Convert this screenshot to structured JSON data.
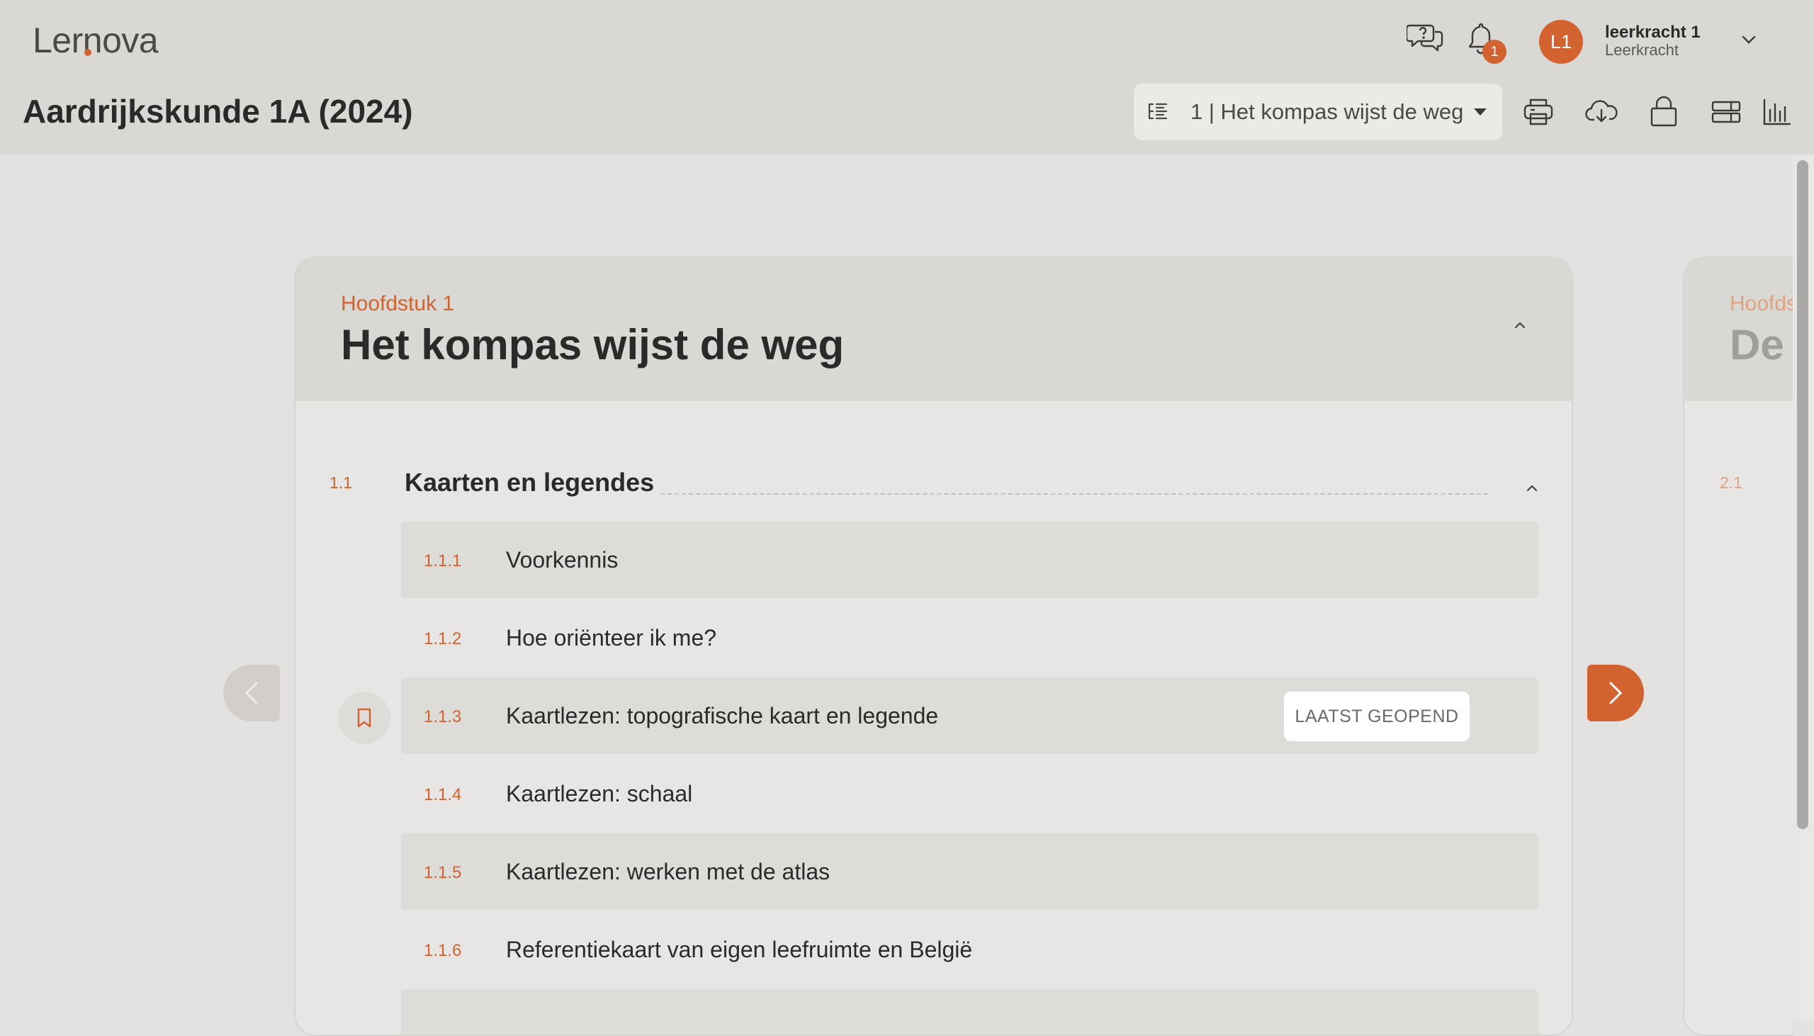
{
  "app": {
    "logo": "Lernova",
    "course_title": "Aardrijkskunde 1A (2024)"
  },
  "header": {
    "notifications_count": "1",
    "user": {
      "initials": "L1",
      "name": "leerkracht 1",
      "role": "Leerkracht"
    },
    "chapter_select": {
      "value": "1 | Het kompas wijst de weg"
    },
    "tools": [
      "print-icon",
      "cloud-download-icon",
      "lock-icon",
      "layout-icon",
      "bar-chart-icon"
    ]
  },
  "colors": {
    "accent": "#d2622f",
    "header_bg": "#d9d8d4",
    "page_bg": "#e3e2e0"
  },
  "chapter": {
    "kicker": "Hoofdstuk 1",
    "title": "Het kompas wijst de weg",
    "section": {
      "number": "1.1",
      "title": "Kaarten en legendes",
      "lessons": [
        {
          "number": "1.1.1",
          "title": "Voorkennis"
        },
        {
          "number": "1.1.2",
          "title": "Hoe oriënteer ik me?"
        },
        {
          "number": "1.1.3",
          "title": "Kaartlezen: topografische kaart en legende",
          "tag": "LAATST GEOPEND"
        },
        {
          "number": "1.1.4",
          "title": "Kaartlezen: schaal"
        },
        {
          "number": "1.1.5",
          "title": "Kaartlezen: werken met de atlas"
        },
        {
          "number": "1.1.6",
          "title": "Referentiekaart van eigen leefruimte en België"
        }
      ]
    }
  },
  "next_chapter": {
    "kicker": "Hoofds",
    "title": "De v",
    "section_number": "2.1"
  }
}
